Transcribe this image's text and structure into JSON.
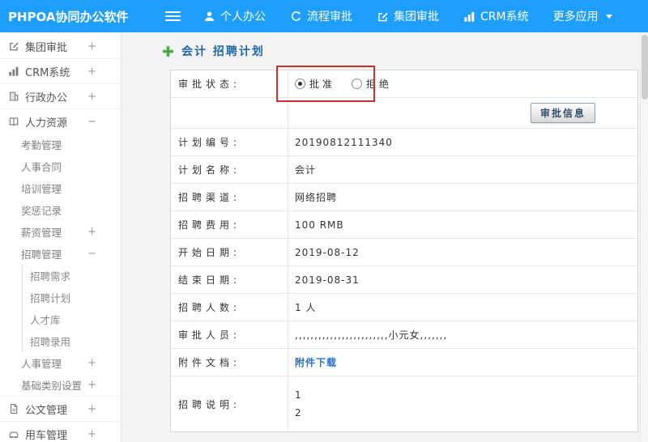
{
  "theme": {
    "topbar_blue": "#1e9fff",
    "annotation_red": "#c9302c",
    "link_blue": "#2571c8",
    "title_blue": "#1f69a8",
    "add_green": "#3aa83a"
  },
  "topbar": {
    "brand": "PHPOA协同办公软件",
    "nav": [
      {
        "label": "个人办公",
        "icon": "person-icon"
      },
      {
        "label": "流程审批",
        "icon": "flow-icon"
      },
      {
        "label": "集团审批",
        "icon": "edit-icon"
      },
      {
        "label": "CRM系统",
        "icon": "chart-icon"
      },
      {
        "label": "更多应用",
        "icon": "caret-down-icon"
      }
    ]
  },
  "sidebar": {
    "items": [
      {
        "label": "集团审批",
        "icon": "edit-icon",
        "toggle": "+"
      },
      {
        "label": "CRM系统",
        "icon": "chart-icon",
        "toggle": "+"
      },
      {
        "label": "行政办公",
        "icon": "office-icon",
        "toggle": "+"
      },
      {
        "label": "人力资源",
        "icon": "hr-book-icon",
        "toggle": "−",
        "children": [
          {
            "label": "考勤管理"
          },
          {
            "label": "人事合同"
          },
          {
            "label": "培训管理"
          },
          {
            "label": "奖惩记录"
          },
          {
            "label": "薪资管理",
            "toggle": "+"
          },
          {
            "label": "招聘管理",
            "toggle": "−",
            "children": [
              {
                "label": "招聘需求"
              },
              {
                "label": "招聘计划"
              },
              {
                "label": "人才库"
              },
              {
                "label": "招聘录用"
              }
            ]
          },
          {
            "label": "人事管理",
            "toggle": "+"
          },
          {
            "label": "基础类别设置",
            "toggle": "+"
          }
        ]
      },
      {
        "label": "公文管理",
        "icon": "doc-icon",
        "toggle": "+"
      },
      {
        "label": "用车管理",
        "icon": "car-icon",
        "toggle": "+"
      }
    ]
  },
  "content": {
    "title": "会计 招聘计划",
    "status": {
      "label": "审批状态:",
      "options": [
        {
          "label": "批准",
          "checked": true
        },
        {
          "label": "拒绝",
          "checked": false
        }
      ]
    },
    "approve_button": "审批信息",
    "fields": [
      {
        "label": "计划编号:",
        "value": "20190812111340"
      },
      {
        "label": "计划名称:",
        "value": "会计"
      },
      {
        "label": "招聘渠道:",
        "value": "网络招聘"
      },
      {
        "label": "招聘费用:",
        "value": "100 RMB"
      },
      {
        "label": "开始日期:",
        "value": "2019-08-12"
      },
      {
        "label": "结束日期:",
        "value": "2019-08-31"
      },
      {
        "label": "招聘人数:",
        "value": "1 人"
      },
      {
        "label": "审批人员:",
        "value": ",,,,,,,,,,,,,,,,,,,,,,,,小元女,,,,,,,"
      },
      {
        "label": "附件文档:",
        "value": "附件下载"
      },
      {
        "label": "招聘说明:",
        "lines": [
          "1",
          "2"
        ]
      }
    ]
  }
}
